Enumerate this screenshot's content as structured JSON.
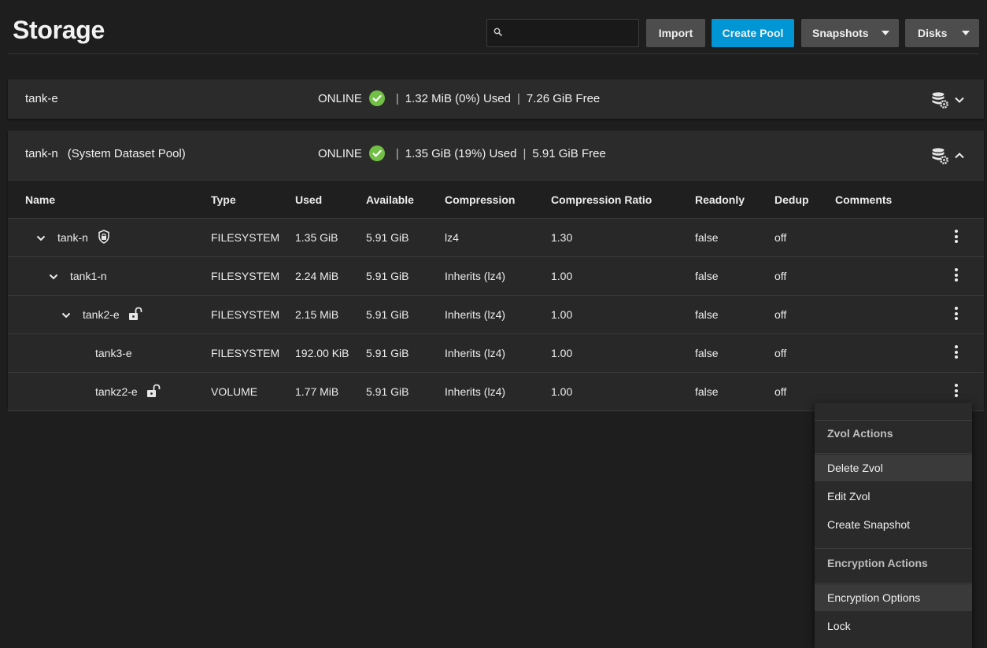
{
  "header": {
    "title": "Storage",
    "search_placeholder": "",
    "buttons": {
      "import": "Import",
      "create_pool": "Create Pool",
      "snapshots": "Snapshots",
      "disks": "Disks"
    }
  },
  "pools": [
    {
      "name": "tank-e",
      "subtitle": "",
      "status": "ONLINE",
      "used": "1.32 MiB (0%) Used",
      "free": "7.26 GiB Free",
      "expanded": false
    },
    {
      "name": "tank-n",
      "subtitle": "(System Dataset Pool)",
      "status": "ONLINE",
      "used": "1.35 GiB (19%) Used",
      "free": "5.91 GiB Free",
      "expanded": true
    }
  ],
  "table": {
    "columns": [
      "Name",
      "Type",
      "Used",
      "Available",
      "Compression",
      "Compression Ratio",
      "Readonly",
      "Dedup",
      "Comments"
    ],
    "rows": [
      {
        "name": "tank-n",
        "type": "FILESYSTEM",
        "used": "1.35 GiB",
        "available": "5.91 GiB",
        "compression": "lz4",
        "ratio": "1.30",
        "readonly": "false",
        "dedup": "off",
        "comments": "",
        "level": 0,
        "expand_icon": "chevron-down-icon",
        "lock_icon": "lock-shield-icon"
      },
      {
        "name": "tank1-n",
        "type": "FILESYSTEM",
        "used": "2.24 MiB",
        "available": "5.91 GiB",
        "compression": "Inherits (lz4)",
        "ratio": "1.00",
        "readonly": "false",
        "dedup": "off",
        "comments": "",
        "level": 1,
        "expand_icon": "chevron-down-icon",
        "lock_icon": ""
      },
      {
        "name": "tank2-e",
        "type": "FILESYSTEM",
        "used": "2.15 MiB",
        "available": "5.91 GiB",
        "compression": "Inherits (lz4)",
        "ratio": "1.00",
        "readonly": "false",
        "dedup": "off",
        "comments": "",
        "level": 2,
        "expand_icon": "chevron-down-icon",
        "lock_icon": "unlocked-icon"
      },
      {
        "name": "tank3-e",
        "type": "FILESYSTEM",
        "used": "192.00 KiB",
        "available": "5.91 GiB",
        "compression": "Inherits (lz4)",
        "ratio": "1.00",
        "readonly": "false",
        "dedup": "off",
        "comments": "",
        "level": 3,
        "expand_icon": "",
        "lock_icon": ""
      },
      {
        "name": "tankz2-e",
        "type": "VOLUME",
        "used": "1.77 MiB",
        "available": "5.91 GiB",
        "compression": "Inherits (lz4)",
        "ratio": "1.00",
        "readonly": "false",
        "dedup": "off",
        "comments": "",
        "level": 3,
        "expand_icon": "",
        "lock_icon": "unlocked-icon"
      }
    ]
  },
  "context_menu": {
    "zvol_header": "Zvol Actions",
    "delete_zvol": "Delete Zvol",
    "edit_zvol": "Edit Zvol",
    "create_snapshot": "Create Snapshot",
    "encryption_header": "Encryption Actions",
    "encryption_options": "Encryption Options",
    "lock": "Lock"
  },
  "colors": {
    "background": "#1e1e1e",
    "card": "#2b2b2b",
    "primary_button": "#0095d5",
    "secondary_button": "#4d4d4d",
    "status_ok": "#71bf44"
  }
}
